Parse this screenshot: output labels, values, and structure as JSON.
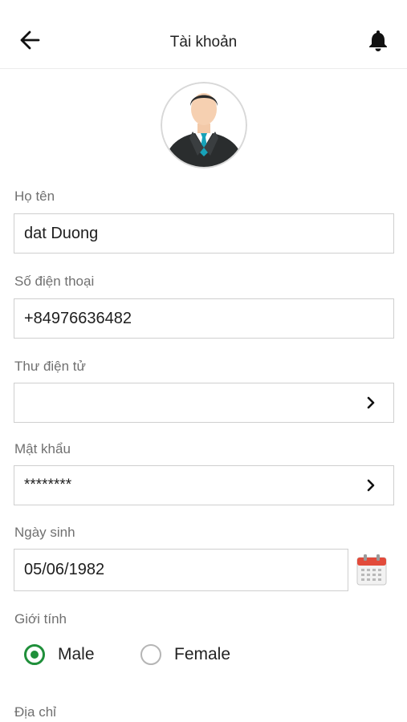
{
  "header": {
    "title": "Tài khoản",
    "back_icon": "arrow-left-icon",
    "bell_icon": "bell-icon"
  },
  "profile": {
    "avatar_icon": "person-avatar-icon"
  },
  "form": {
    "name": {
      "label": "Họ tên",
      "value": "dat Duong"
    },
    "phone": {
      "label": "Số điện thoại",
      "value": "+84976636482"
    },
    "email": {
      "label": "Thư điện tử",
      "value": ""
    },
    "password": {
      "label": "Mật khẩu",
      "value": "********"
    },
    "birthday": {
      "label": "Ngày sinh",
      "value": "05/06/1982"
    },
    "gender": {
      "label": "Giới tính",
      "options": [
        "Male",
        "Female"
      ],
      "selected": "Male"
    },
    "address": {
      "label": "Địa chỉ"
    }
  },
  "colors": {
    "accent": "#1f8f3a",
    "calendar_red": "#e24b3b"
  }
}
